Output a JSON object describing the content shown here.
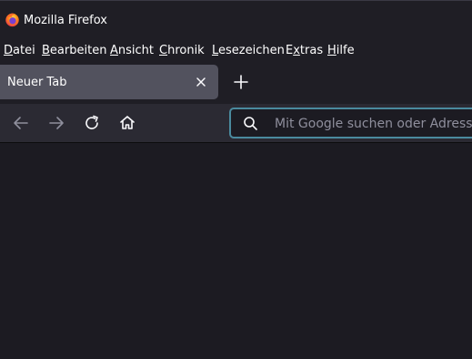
{
  "window": {
    "title": "Mozilla Firefox"
  },
  "menubar": {
    "items": [
      {
        "label": "Datei"
      },
      {
        "label": "Bearbeiten"
      },
      {
        "label": "Ansicht"
      },
      {
        "label": "Chronik"
      },
      {
        "label": "Lesezeichen"
      },
      {
        "label": "Extras"
      },
      {
        "label": "Hilfe"
      }
    ]
  },
  "tabs": [
    {
      "label": "Neuer Tab",
      "active": true
    }
  ],
  "toolbar": {
    "back_icon": "arrow-left-icon",
    "forward_icon": "arrow-right-icon",
    "reload_icon": "reload-icon",
    "home_icon": "home-icon"
  },
  "urlbar": {
    "placeholder": "Mit Google suchen oder Adresse eingeben",
    "value": ""
  },
  "colors": {
    "background": "#1c1b22",
    "chrome": "#1f1e25",
    "navbar": "#2b2a33",
    "tab_active": "#52525e",
    "focus_ring": "#4a8a9e",
    "text": "#ffffff",
    "placeholder": "#8f8f9d"
  }
}
